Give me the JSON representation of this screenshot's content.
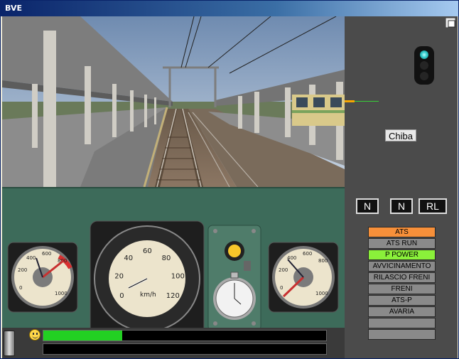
{
  "window": {
    "title": "BVE"
  },
  "view": {
    "station_name": "Chiba"
  },
  "speedometer": {
    "unit": "km/h",
    "ticks": [
      "0",
      "20",
      "40",
      "60",
      "80",
      "100",
      "120"
    ]
  },
  "mode_indicators": {
    "left": "N",
    "middle": "N",
    "right": "RL"
  },
  "indicators": [
    {
      "label": "ATS",
      "color": "#f7903a"
    },
    {
      "label": "ATS RUN",
      "color": "#8a8a8a"
    },
    {
      "label": "P POWER",
      "color": "#8af03a"
    },
    {
      "label": "AVVICINAMENTO",
      "color": "#8a8a8a"
    },
    {
      "label": "RILASCIO FRENI",
      "color": "#8a8a8a"
    },
    {
      "label": "FRENI",
      "color": "#8a8a8a"
    },
    {
      "label": "ATS-P",
      "color": "#8a8a8a"
    },
    {
      "label": "AVARIA",
      "color": "#8a8a8a"
    },
    {
      "label": "",
      "color": "#8a8a8a"
    },
    {
      "label": "",
      "color": "#8a8a8a"
    }
  ],
  "status": {
    "power_bar_fraction": 0.28
  }
}
